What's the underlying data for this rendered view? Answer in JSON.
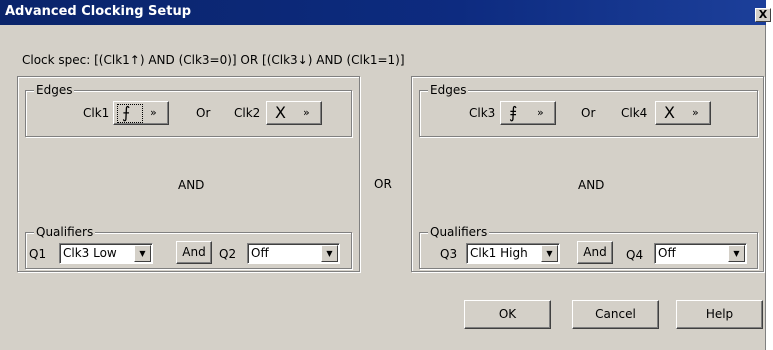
{
  "window": {
    "title": "Advanced Clocking Setup",
    "close_label": "X"
  },
  "clock_spec": "Clock spec: [(Clk1↑) AND (Clk3=0)]  OR  [(Clk3↓) AND (Clk1=1)]",
  "connector_or": "OR",
  "left_panel": {
    "edges": {
      "legend": "Edges",
      "label_a": "Clk1",
      "glyph_a": "⨍",
      "or_label": "Or",
      "label_b": "Clk2",
      "glyph_b": "X",
      "chevron": "»"
    },
    "and_label": "AND",
    "qualifiers": {
      "legend": "Qualifiers",
      "label_a": "Q1",
      "value_a": "Clk3 Low",
      "and_button": "And",
      "label_b": "Q2",
      "value_b": "Off"
    }
  },
  "right_panel": {
    "edges": {
      "legend": "Edges",
      "label_a": "Clk3",
      "glyph_a": "⨎",
      "or_label": "Or",
      "label_b": "Clk4",
      "glyph_b": "X",
      "chevron": "»"
    },
    "and_label": "AND",
    "qualifiers": {
      "legend": "Qualifiers",
      "label_a": "Q3",
      "value_a": "Clk1 High",
      "and_button": "And",
      "label_b": "Q4",
      "value_b": "Off"
    }
  },
  "buttons": {
    "ok": "OK",
    "cancel": "Cancel",
    "help": "Help"
  },
  "icons": {
    "dropdown_arrow": "▼"
  },
  "colors": {
    "titlebar": "#0a246a",
    "face": "#d4d0c8"
  }
}
